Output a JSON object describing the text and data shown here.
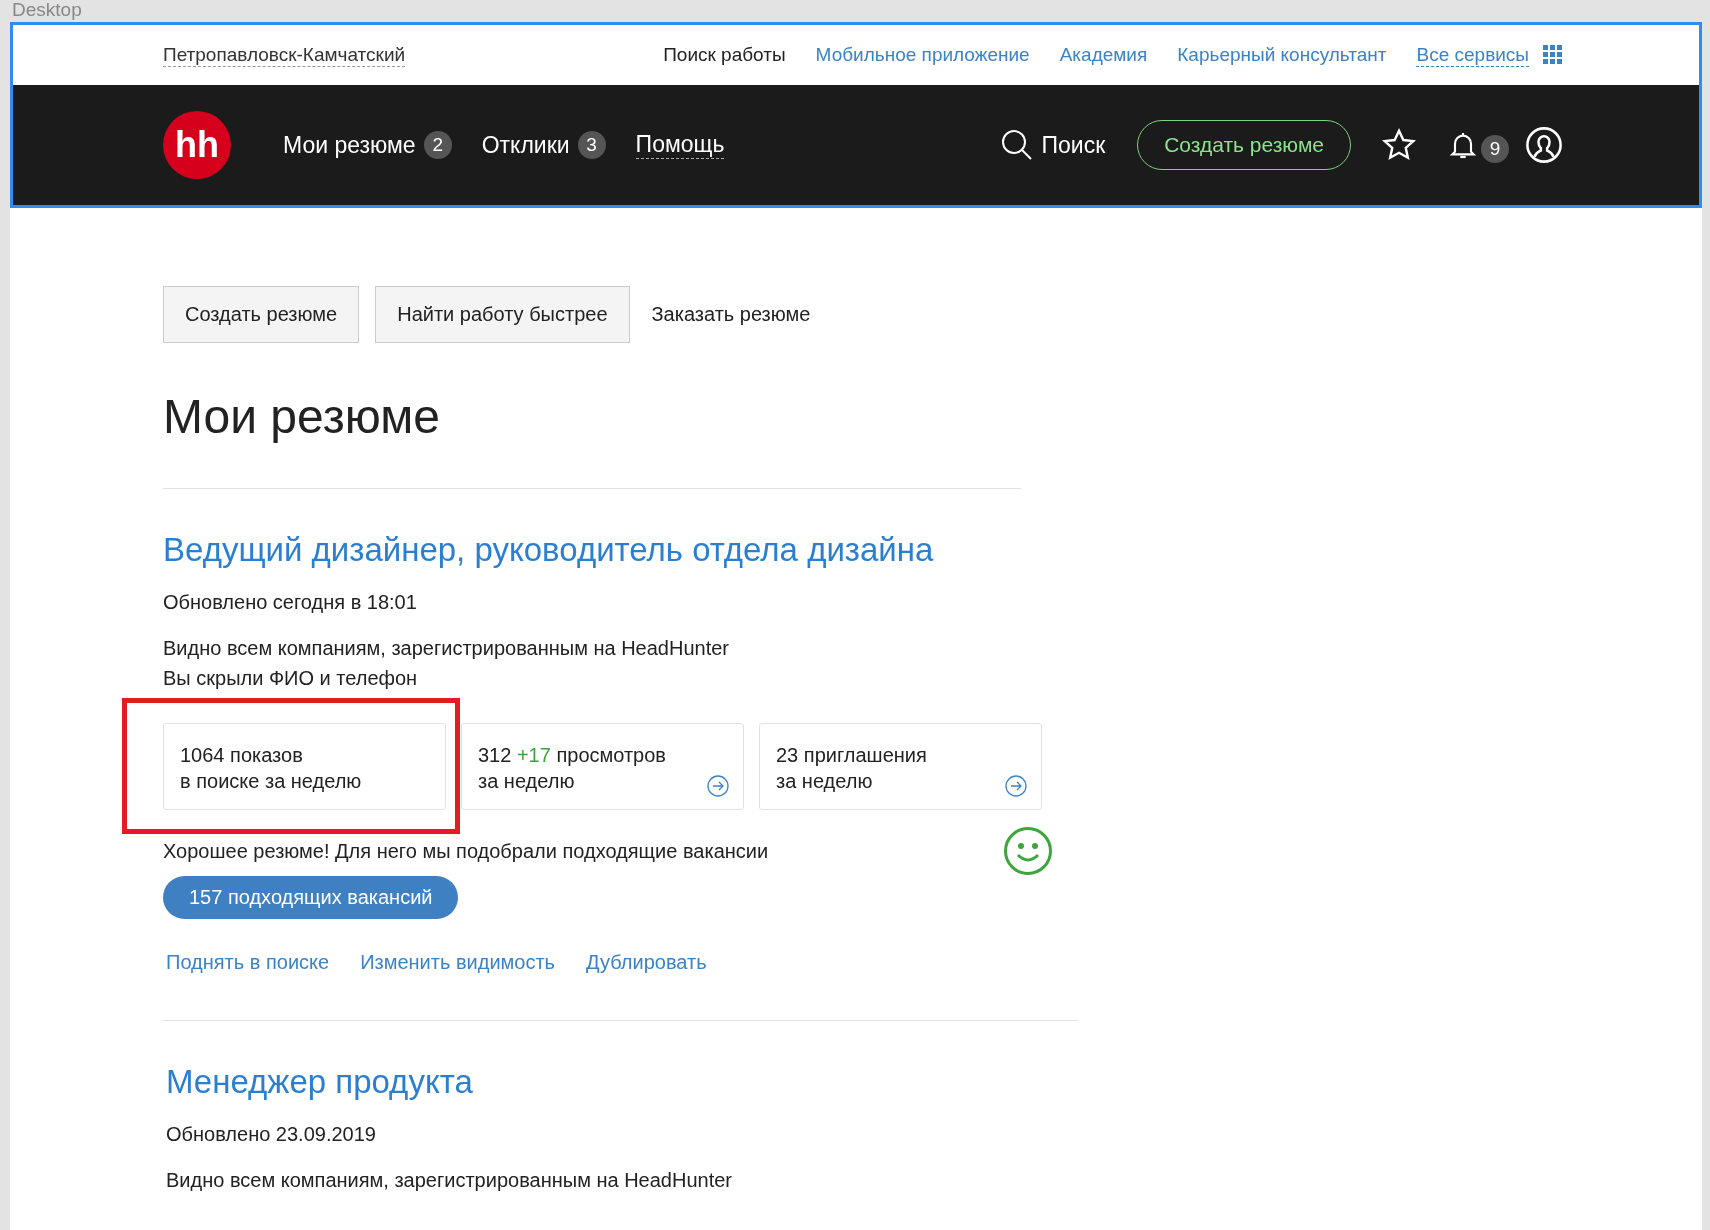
{
  "frame_label": "Desktop",
  "top_bar": {
    "city": "Петропавловск-Камчатский",
    "links": [
      {
        "label": "Поиск работы",
        "kind": "plain"
      },
      {
        "label": "Мобильное приложение",
        "kind": "link"
      },
      {
        "label": "Академия",
        "kind": "link"
      },
      {
        "label": "Карьерный консультант",
        "kind": "link"
      }
    ],
    "all_services": "Все сервисы"
  },
  "nav": {
    "logo": "hh",
    "items": [
      {
        "label": "Мои резюме",
        "badge": "2",
        "dashed": false
      },
      {
        "label": "Отклики",
        "badge": "3",
        "dashed": false
      },
      {
        "label": "Помощь",
        "dashed": true
      }
    ],
    "search": "Поиск",
    "create": "Создать резюме",
    "notifications": "9"
  },
  "actions": [
    {
      "label": "Создать резюме",
      "kind": "button"
    },
    {
      "label": "Найти работу быстрее",
      "kind": "button"
    },
    {
      "label": "Заказать резюме",
      "kind": "text"
    }
  ],
  "page_title": "Мои резюме",
  "resumes": [
    {
      "title": "Ведущий дизайнер, руководитель отдела дизайна",
      "updated": "Обновлено сегодня в 18:01",
      "visibility": "Видно всем компаниям, зарегистрированным на HeadHunter",
      "hidden": "Вы скрыли ФИО и телефон",
      "stats": [
        {
          "count": "1064",
          "label": "показов",
          "sub": "в поиске за неделю",
          "arrow": false,
          "highlighted": true
        },
        {
          "count": "312",
          "delta": "+17",
          "label": "просмотров",
          "sub": "за неделю",
          "arrow": true,
          "highlighted": false
        },
        {
          "count": "23",
          "label": "приглашения",
          "sub": "за неделю",
          "arrow": true,
          "highlighted": false
        }
      ],
      "feedback": "Хорошее резюме! Для него мы подобрали подходящие вакансии",
      "vacancies_button": "157 подходящих вакансий",
      "links": [
        "Поднять в поиске",
        "Изменить видимость",
        "Дублировать"
      ]
    },
    {
      "title": "Менеджер продукта",
      "updated": "Обновлено 23.09.2019",
      "visibility": "Видно всем компаниям, зарегистрированным на HeadHunter"
    }
  ]
}
